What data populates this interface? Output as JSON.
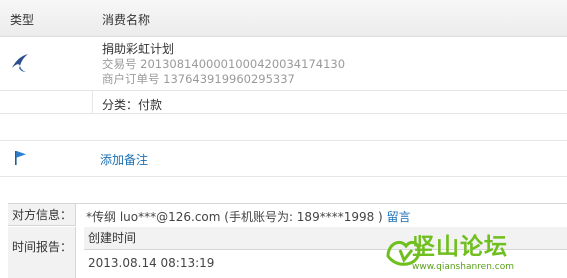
{
  "header": {
    "col_type": "类型",
    "col_name": "消费名称"
  },
  "item": {
    "title": "捐助彩虹计划",
    "trade_no": "交易号 2013081400001000420034174130",
    "merchant_order": "商户订单号 137643919960295337",
    "category": "分类：付款",
    "icon": "bird-icon"
  },
  "note": {
    "label": "添加备注",
    "icon": "flag-icon"
  },
  "counterparty": {
    "label": "对方信息：",
    "text": "*传纲 luo***@126.com (手机账号为: 189****1998 )",
    "link": "留言"
  },
  "report": {
    "label": "时间报告：",
    "head": "创建时间",
    "value": "2013.08.14 08:13:19"
  },
  "watermark": {
    "text": "坚山论坛",
    "url": "www.qianshanren.com"
  },
  "colors": {
    "link": "#1a6fb4",
    "muted": "#9a9a9a",
    "watermark": "#6fbf1e"
  }
}
